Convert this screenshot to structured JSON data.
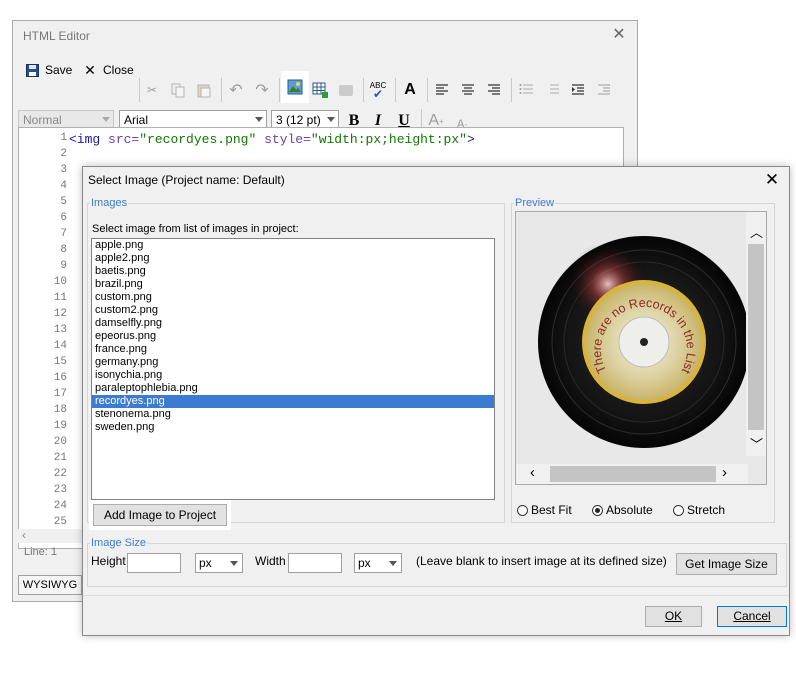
{
  "editor": {
    "title": "HTML Editor",
    "toolbar": {
      "save_label": "Save",
      "close_label": "Close"
    },
    "style_combo": "Normal",
    "font_combo": "Arial",
    "size_combo": "3 (12 pt)",
    "bold": "B",
    "italic": "I",
    "underline": "U",
    "code": {
      "line_numbers": [
        "1",
        "2",
        "3",
        "4",
        "5",
        "6",
        "7",
        "8",
        "9",
        "10",
        "11",
        "12",
        "13",
        "14",
        "15",
        "16",
        "17",
        "18",
        "19",
        "20",
        "21",
        "22",
        "23",
        "24",
        "25"
      ],
      "tag_open": "<img",
      "attr_src": "src=",
      "val_src": "\"recordyes.png\"",
      "attr_style": "style=",
      "val_style": "\"width:px;height:px\"",
      "tag_close": ">"
    },
    "status": "Line: 1",
    "tab_wysiwyg": "WYSIWYG"
  },
  "dialog": {
    "title": "Select Image (Project name: Default)",
    "images_legend": "Images",
    "images_instruction": "Select image from list of images in project:",
    "images": [
      "apple.png",
      "apple2.png",
      "baetis.png",
      "brazil.png",
      "custom.png",
      "custom2.png",
      "damselfly.png",
      "epeorus.png",
      "france.png",
      "germany.png",
      "isonychia.png",
      "paraleptophlebia.png",
      "recordyes.png",
      "stenonema.png",
      "sweden.png"
    ],
    "selected_image": "recordyes.png",
    "add_button": "Add Image to Project",
    "preview_legend": "Preview",
    "preview_caption": "There are no Records in the List",
    "fit_options": {
      "best_fit": "Best Fit",
      "absolute": "Absolute",
      "stretch": "Stretch"
    },
    "fit_selected": "Absolute",
    "size_legend": "Image Size",
    "height_label": "Height",
    "width_label": "Width",
    "height_unit": "px",
    "width_unit": "px",
    "size_hint": "(Leave blank to insert image at its defined size)",
    "get_size_button": "Get Image Size",
    "ok_button": "OK",
    "cancel_button": "Cancel"
  },
  "colors": {
    "selection": "#3b7bd1",
    "legend": "#3c7ac8",
    "record_label": "#e9c447"
  }
}
